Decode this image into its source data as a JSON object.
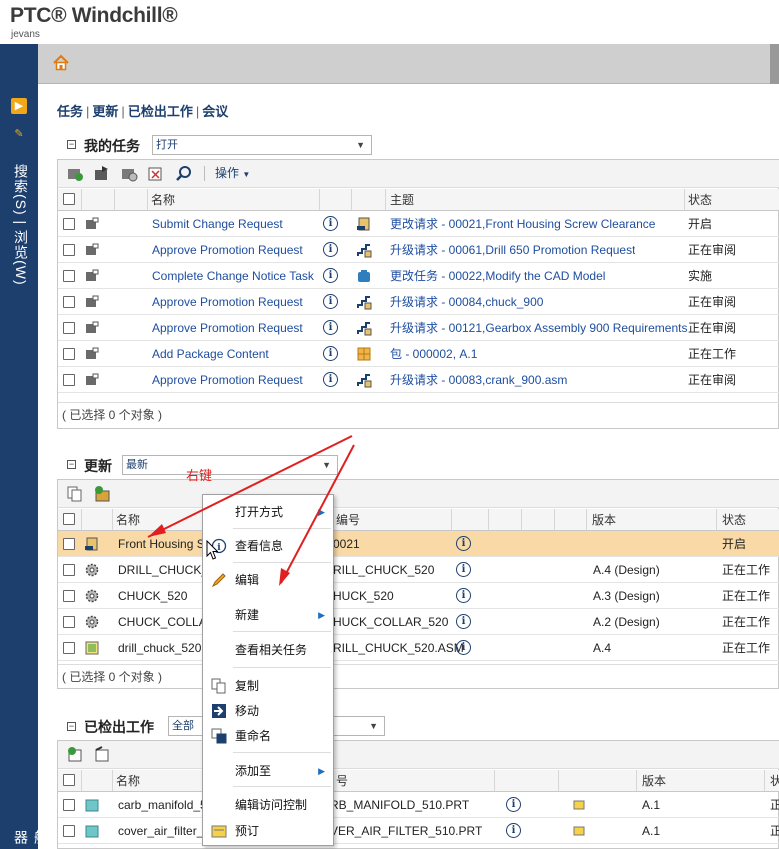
{
  "app": {
    "logo": "PTC® Windchill®",
    "user": "jevans"
  },
  "nav": {
    "search_label": "搜索(S)",
    "browse_label": "浏览(W)",
    "navigator_label": "导航器"
  },
  "tabs": [
    {
      "label": "任务"
    },
    {
      "label": "更新"
    },
    {
      "label": "已检出工作"
    },
    {
      "label": "会议"
    }
  ],
  "my_tasks": {
    "title": "我的任务",
    "filter": "打开",
    "actions_label": "操作",
    "headers": {
      "name": "名称",
      "subject": "主题",
      "status": "状态"
    },
    "rows": [
      {
        "name": "Submit Change Request",
        "subject": "更改请求 - 00021,Front Housing Screw Clearance",
        "status": "开启",
        "type_icon": "change-request-icon"
      },
      {
        "name": "Approve Promotion Request",
        "subject": "升级请求 - 00061,Drill 650 Promotion Request",
        "status": "正在审阅",
        "type_icon": "promotion-request-icon"
      },
      {
        "name": "Complete Change Notice Task",
        "subject": "更改任务 - 00022,Modify the CAD Model",
        "status": "实施",
        "type_icon": "change-task-icon"
      },
      {
        "name": "Approve Promotion Request",
        "subject": "升级请求 - 00084,chuck_900",
        "status": "正在审阅",
        "type_icon": "promotion-request-icon"
      },
      {
        "name": "Approve Promotion Request",
        "subject": "升级请求 - 00121,Gearbox Assembly 900 Requirements",
        "status": "正在审阅",
        "type_icon": "promotion-request-icon"
      },
      {
        "name": "Add Package Content",
        "subject": "包 - 000002, A.1",
        "status": "正在工作",
        "type_icon": "package-icon"
      },
      {
        "name": "Approve Promotion Request",
        "subject": "升级请求 - 00083,crank_900.asm",
        "status": "正在审阅",
        "type_icon": "promotion-request-icon"
      }
    ],
    "footer": "( 已选择 0 个对象 )"
  },
  "updates": {
    "title": "更新",
    "filter": "最新",
    "headers": {
      "name": "名称",
      "number": "编号",
      "version": "版本",
      "status": "状态"
    },
    "rows": [
      {
        "name": "Front Housing S",
        "number": "0021",
        "version": "",
        "status": "开启",
        "highlight": true
      },
      {
        "name": "DRILL_CHUCK_5",
        "number": "RILL_CHUCK_520",
        "version": "A.4 (Design)",
        "status": "正在工作"
      },
      {
        "name": "CHUCK_520",
        "number": "HUCK_520",
        "version": "A.3 (Design)",
        "status": "正在工作"
      },
      {
        "name": "CHUCK_COLLAR",
        "number": "HUCK_COLLAR_520",
        "version": "A.2 (Design)",
        "status": "正在工作"
      },
      {
        "name": "drill_chuck_520.a",
        "number": "RILL_CHUCK_520.ASM",
        "version": "A.4",
        "status": "正在工作"
      }
    ],
    "footer": "( 已选择 0 个对象 )"
  },
  "checked_out": {
    "title": "已检出工作",
    "filter": "全部",
    "headers": {
      "name": "名称",
      "number": "号",
      "version": "版本",
      "status": "状"
    },
    "rows": [
      {
        "name": "carb_manifold_5",
        "number": "RB_MANIFOLD_510.PRT",
        "version": "A.1",
        "status": "正"
      },
      {
        "name": "cover_air_filter_5",
        "number": "VER_AIR_FILTER_510.PRT",
        "version": "A.1",
        "status": "正"
      }
    ]
  },
  "context_menu": {
    "items": [
      {
        "label": "打开方式",
        "submenu": true
      },
      {
        "label": "查看信息",
        "submenu": false
      },
      {
        "label": "编辑",
        "submenu": false
      },
      {
        "label": "新建",
        "submenu": true
      },
      {
        "label": "查看相关任务",
        "submenu": false
      },
      {
        "label": "复制",
        "submenu": false
      },
      {
        "label": "移动",
        "submenu": false
      },
      {
        "label": "重命名",
        "submenu": false
      },
      {
        "label": "添加至",
        "submenu": true
      },
      {
        "label": "编辑访问控制",
        "submenu": false
      },
      {
        "label": "预订",
        "submenu": false
      }
    ]
  },
  "annotation": {
    "text": "右键",
    "color": "#e02020"
  },
  "colors": {
    "nav_bg": "#1d3f6e",
    "highlight": "#f9d9a6",
    "link": "#1f4ea0",
    "accent": "#f0a818"
  }
}
